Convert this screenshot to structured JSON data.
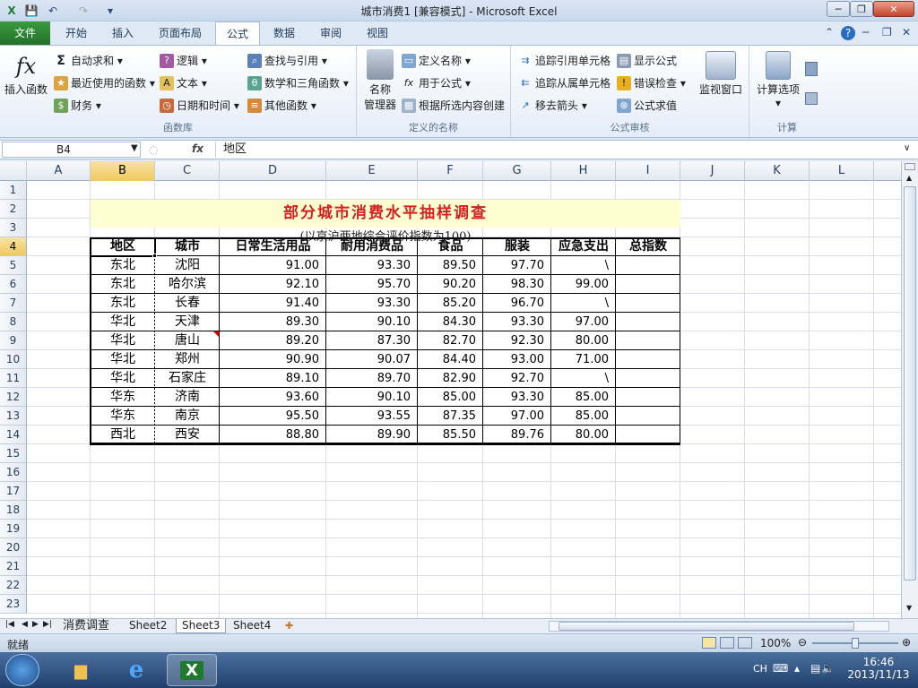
{
  "window": {
    "title": "城市消费1  [兼容模式] - Microsoft Excel",
    "minimize": "─",
    "restore": "❐",
    "close": "✕"
  },
  "quick_access": {
    "save": "💾",
    "undo": "↶",
    "redo": "↷",
    "customize": "▾"
  },
  "tabs": [
    {
      "label": "文件"
    },
    {
      "label": "开始"
    },
    {
      "label": "插入"
    },
    {
      "label": "页面布局"
    },
    {
      "label": "公式"
    },
    {
      "label": "数据"
    },
    {
      "label": "审阅"
    },
    {
      "label": "视图"
    }
  ],
  "ribbon": {
    "function_library": {
      "label": "函数库",
      "insert_function": "插入函数",
      "autosum": "自动求和 ▾",
      "recent": "最近使用的函数 ▾",
      "financial": "财务 ▾",
      "logical": "逻辑 ▾",
      "text": "文本 ▾",
      "datetime": "日期和时间 ▾",
      "lookup": "查找与引用 ▾",
      "math": "数学和三角函数 ▾",
      "other": "其他函数 ▾"
    },
    "defined_names": {
      "label": "定义的名称",
      "name_manager_1": "名称",
      "name_manager_2": "管理器",
      "define_name": "定义名称 ▾",
      "use_in_formula": "用于公式 ▾",
      "create_from_selection": "根据所选内容创建"
    },
    "formula_auditing": {
      "label": "公式审核",
      "trace_precedents": "追踪引用单元格",
      "trace_dependents": "追踪从属单元格",
      "remove_arrows": "移去箭头 ▾",
      "show_formulas": "显示公式",
      "error_checking": "错误检查 ▾",
      "evaluate_formula": "公式求值",
      "watch_window": "监视窗口"
    },
    "calculation": {
      "label": "计算",
      "options": "计算选项",
      "options_arrow": "▾"
    }
  },
  "formula_bar": {
    "name_box": "B4",
    "fx": "fx",
    "content": "地区"
  },
  "columns": [
    "A",
    "B",
    "C",
    "D",
    "E",
    "F",
    "G",
    "H",
    "I",
    "J",
    "K",
    "L"
  ],
  "rows": [
    "1",
    "2",
    "3",
    "4",
    "5",
    "6",
    "7",
    "8",
    "9",
    "10",
    "11",
    "12",
    "13",
    "14",
    "15",
    "16",
    "17",
    "18",
    "19",
    "20",
    "21",
    "22",
    "23"
  ],
  "sheet": {
    "title": "部分城市消费水平抽样调查",
    "subtitle": "(以京沪两地综合评价指数为100)",
    "headers": [
      "地区",
      "城市",
      "日常生活用品",
      "耐用消费品",
      "食品",
      "服装",
      "应急支出",
      "总指数"
    ],
    "data": [
      [
        "东北",
        "沈阳",
        "91.00",
        "93.30",
        "89.50",
        "97.70",
        "\\",
        ""
      ],
      [
        "东北",
        "哈尔滨",
        "92.10",
        "95.70",
        "90.20",
        "98.30",
        "99.00",
        ""
      ],
      [
        "东北",
        "长春",
        "91.40",
        "93.30",
        "85.20",
        "96.70",
        "\\",
        ""
      ],
      [
        "华北",
        "天津",
        "89.30",
        "90.10",
        "84.30",
        "93.30",
        "97.00",
        ""
      ],
      [
        "华北",
        "唐山",
        "89.20",
        "87.30",
        "82.70",
        "92.30",
        "80.00",
        ""
      ],
      [
        "华北",
        "郑州",
        "90.90",
        "90.07",
        "84.40",
        "93.00",
        "71.00",
        ""
      ],
      [
        "华北",
        "石家庄",
        "89.10",
        "89.70",
        "82.90",
        "92.70",
        "\\",
        ""
      ],
      [
        "华东",
        "济南",
        "93.60",
        "90.10",
        "85.00",
        "93.30",
        "85.00",
        ""
      ],
      [
        "华东",
        "南京",
        "95.50",
        "93.55",
        "87.35",
        "97.00",
        "85.00",
        ""
      ],
      [
        "西北",
        "西安",
        "88.80",
        "89.90",
        "85.50",
        "89.76",
        "80.00",
        ""
      ]
    ]
  },
  "sheet_tabs": [
    "消费调查",
    "Sheet2",
    "Sheet3",
    "Sheet4"
  ],
  "status": {
    "ready": "就绪",
    "zoom": "100%"
  },
  "taskbar": {
    "lang": "CH",
    "time": "16:46",
    "date": "2013/11/13"
  }
}
